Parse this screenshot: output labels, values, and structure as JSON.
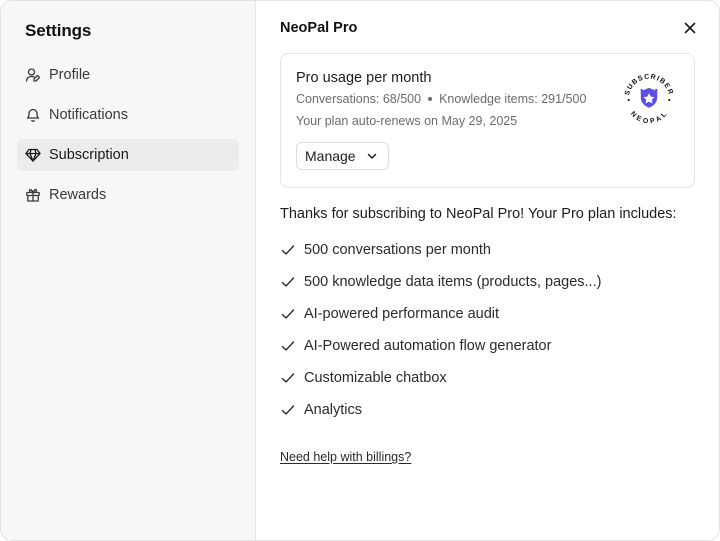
{
  "sidebar": {
    "title": "Settings",
    "items": [
      {
        "label": "Profile",
        "icon": "user-pen-icon",
        "active": false
      },
      {
        "label": "Notifications",
        "icon": "bell-icon",
        "active": false
      },
      {
        "label": "Subscription",
        "icon": "gem-icon",
        "active": true
      },
      {
        "label": "Rewards",
        "icon": "gift-icon",
        "active": false
      }
    ]
  },
  "main": {
    "title": "NeoPal Pro",
    "close_icon": "close-icon",
    "usage": {
      "title": "Pro usage per month",
      "conversations": "Conversations: 68/500",
      "knowledge": "Knowledge items: 291/500",
      "renews": "Your plan auto-renews on May 29, 2025",
      "manage_label": "Manage",
      "badge_top_text": "SUBSCRIBER",
      "badge_bottom_text": "NEOPAL"
    },
    "thanks": "Thanks for subscribing to NeoPal Pro! Your Pro plan includes:",
    "features": [
      "500 conversations per month",
      "500 knowledge data items (products, pages...)",
      "AI-powered performance audit",
      "AI-Powered automation flow generator",
      "Customizable chatbox",
      "Analytics"
    ],
    "help_link": "Need help with billings?"
  },
  "colors": {
    "sidebar_bg": "#f7f7f5",
    "active_bg": "#ececea",
    "badge_accent": "#5b4fe0",
    "text": "#1c1c1c",
    "muted": "#6b6b6b"
  }
}
